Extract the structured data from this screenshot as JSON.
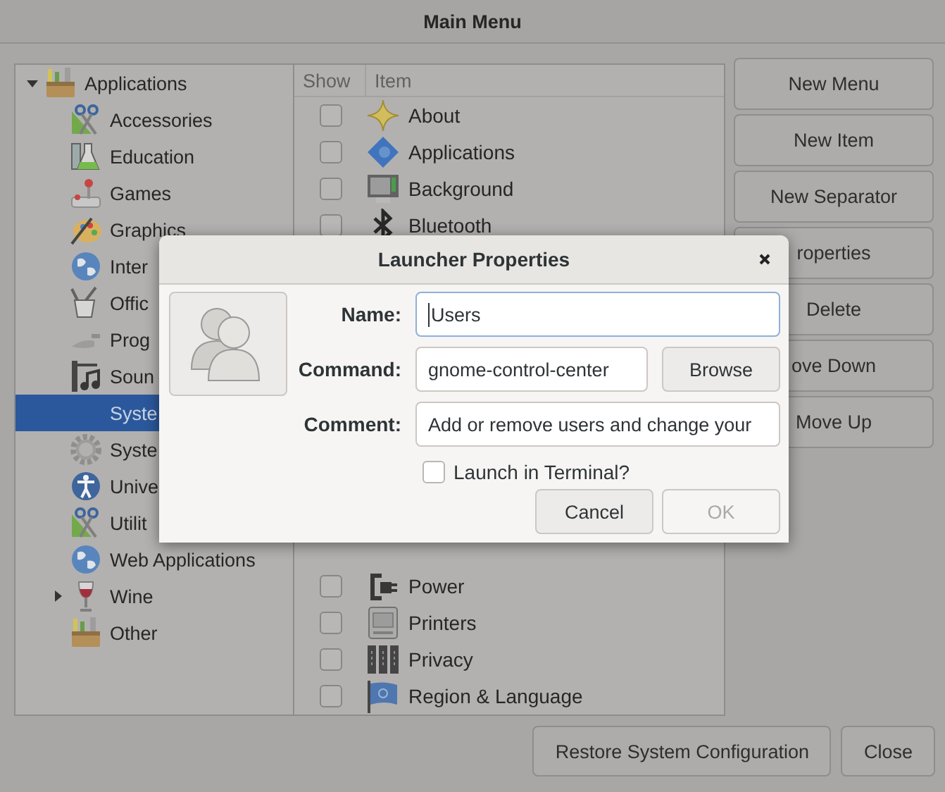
{
  "window": {
    "title": "Main Menu"
  },
  "tree": [
    {
      "label": "Applications",
      "expanded": true,
      "selected": false,
      "children": [
        {
          "label": "Accessories",
          "selected": false
        },
        {
          "label": "Education",
          "selected": false
        },
        {
          "label": "Games",
          "selected": false
        },
        {
          "label": "Graphics",
          "selected": false
        },
        {
          "label": "Inter",
          "selected": false
        },
        {
          "label": "Offic",
          "selected": false
        },
        {
          "label": "Prog",
          "selected": false
        },
        {
          "label": "Soun",
          "selected": false
        },
        {
          "label": "Syste",
          "selected": true
        },
        {
          "label": "Syste",
          "selected": false
        },
        {
          "label": "Unive",
          "selected": false
        },
        {
          "label": "Utilit",
          "selected": false
        },
        {
          "label": "Web Applications",
          "selected": false
        },
        {
          "label": "Wine",
          "expanded": false,
          "selected": false
        },
        {
          "label": "Other",
          "selected": false
        }
      ]
    }
  ],
  "list": {
    "columns": [
      "Show",
      "Item"
    ],
    "top_items": [
      {
        "label": "About",
        "show": false
      },
      {
        "label": "Applications",
        "show": false
      },
      {
        "label": "Background",
        "show": false
      },
      {
        "label": "Bluetooth",
        "show": false
      }
    ],
    "bottom_items": [
      {
        "label": "Power",
        "show": false
      },
      {
        "label": "Printers",
        "show": false
      },
      {
        "label": "Privacy",
        "show": false
      },
      {
        "label": "Region & Language",
        "show": false
      }
    ]
  },
  "side_buttons": [
    "New Menu",
    "New Item",
    "New Separator",
    "roperties",
    "Delete",
    "ove Down",
    "Move Up"
  ],
  "footer_buttons": [
    "Restore System Configuration",
    "Close"
  ],
  "dialog": {
    "title": "Launcher Properties",
    "fields": [
      {
        "label": "Name:",
        "value": "Users",
        "focused": true
      },
      {
        "label": "Command:",
        "value": "gnome-control-center",
        "focused": false,
        "button": "Browse"
      },
      {
        "label": "Comment:",
        "value": "Add or remove users and change your",
        "focused": false
      }
    ],
    "launch_in_terminal": {
      "label": "Launch in Terminal?",
      "checked": false
    },
    "buttons": [
      {
        "label": "Cancel",
        "disabled": false
      },
      {
        "label": "OK",
        "disabled": true
      }
    ]
  }
}
